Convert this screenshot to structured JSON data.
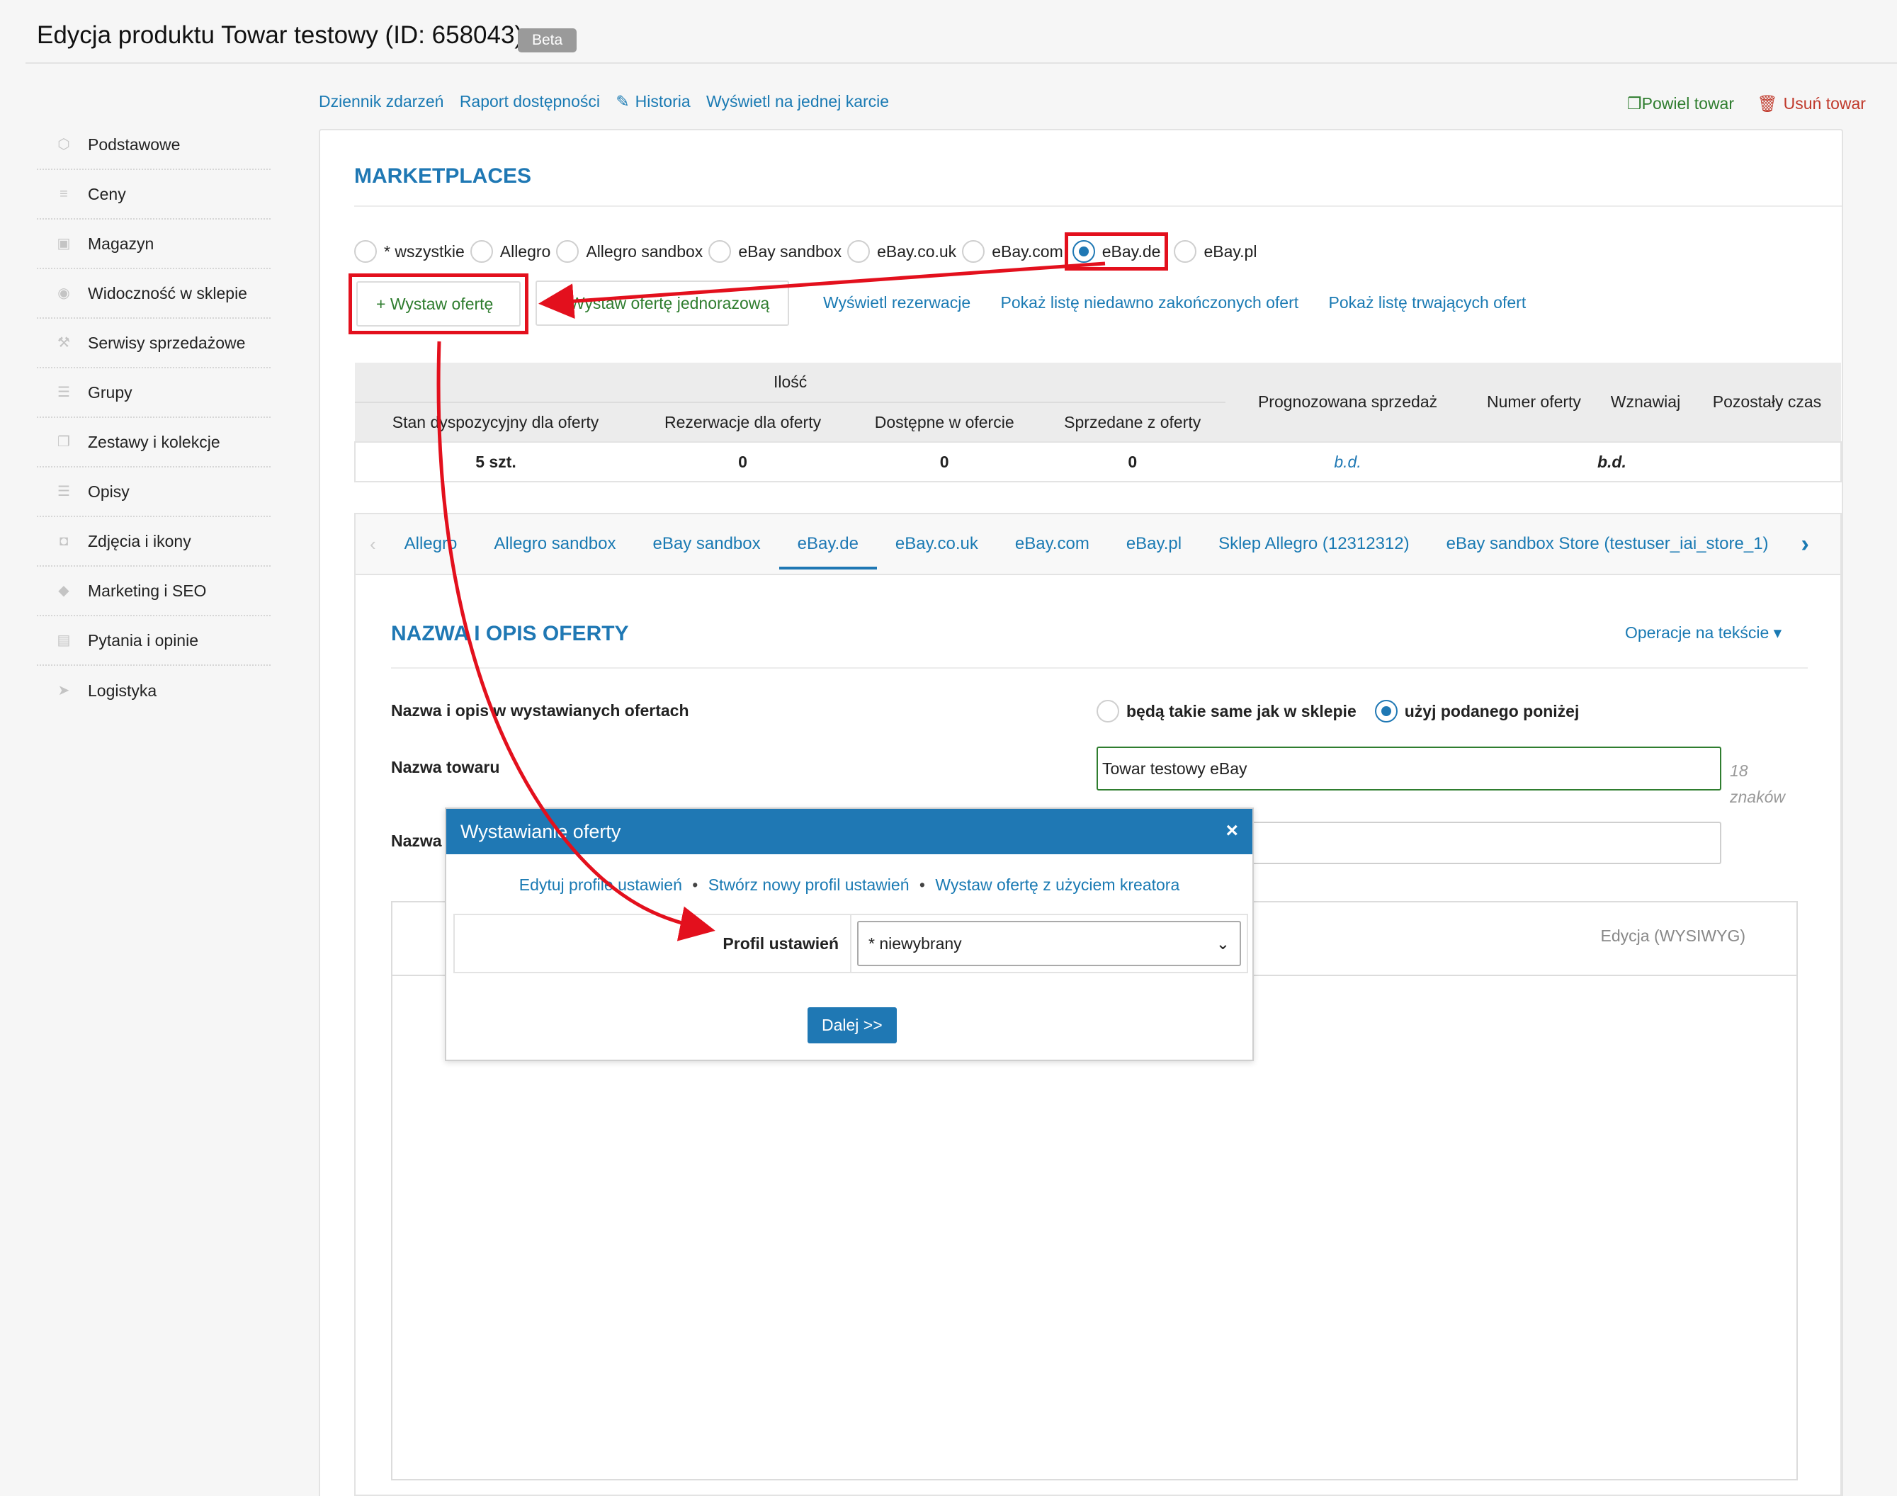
{
  "page": {
    "title": "Edycja produktu Towar testowy (ID: 658043)",
    "badge": "Beta"
  },
  "sidebar": {
    "items": [
      {
        "label": "Podstawowe",
        "icon": "cube-icon"
      },
      {
        "label": "Ceny",
        "icon": "coins-icon"
      },
      {
        "label": "Magazyn",
        "icon": "warehouse-icon"
      },
      {
        "label": "Widoczność w sklepie",
        "icon": "eye-icon"
      },
      {
        "label": "Serwisy sprzedażowe",
        "icon": "hammer-icon"
      },
      {
        "label": "Grupy",
        "icon": "layers-icon"
      },
      {
        "label": "Zestawy i kolekcje",
        "icon": "copy-icon"
      },
      {
        "label": "Opisy",
        "icon": "lines-icon"
      },
      {
        "label": "Zdjęcia i ikony",
        "icon": "camera-icon"
      },
      {
        "label": "Marketing i SEO",
        "icon": "tag-icon"
      },
      {
        "label": "Pytania i opinie",
        "icon": "chat-icon"
      },
      {
        "label": "Logistyka",
        "icon": "plane-icon"
      }
    ]
  },
  "toplinks": {
    "log": "Dziennik zdarzeń",
    "report": "Raport dostępności",
    "history": "Historia",
    "single_card": "Wyświetl na jednej karcie",
    "duplicate": "Powiel towar",
    "delete": "Usuń towar"
  },
  "marketplaces": {
    "title": "MARKETPLACES",
    "options": [
      "* wszystkie",
      "Allegro",
      "Allegro sandbox",
      "eBay sandbox",
      "eBay.co.uk",
      "eBay.com",
      "eBay.de",
      "eBay.pl"
    ],
    "selected": "eBay.de",
    "btn_offer": "+   Wystaw ofertę",
    "btn_single": "+   Wystaw ofertę jednorazową",
    "link_res": "Wyświetl rezerwacje",
    "link_ended": "Pokaż listę niedawno zakończonych ofert",
    "link_ongoing": "Pokaż listę trwających ofert"
  },
  "qty_table": {
    "group": "Ilość",
    "headers": [
      "Stan dyspozycyjny dla oferty",
      "Rezerwacje dla oferty",
      "Dostępne w ofercie",
      "Sprzedane z oferty",
      "Prognozowana sprzedaż",
      "Numer oferty",
      "Wznawiaj",
      "Pozostały czas"
    ],
    "row": {
      "stan": "5 szt.",
      "rez": "0",
      "dost": "0",
      "sprz": "0",
      "prog": "b.d.",
      "num": "b.d."
    }
  },
  "tabs": {
    "items": [
      "Allegro",
      "Allegro sandbox",
      "eBay sandbox",
      "eBay.de",
      "eBay.co.uk",
      "eBay.com",
      "eBay.pl",
      "Sklep Allegro (12312312)",
      "eBay sandbox Store (testuser_iai_store_1)"
    ],
    "active": "eBay.de"
  },
  "section": {
    "title": "NAZWA I OPIS OFERTY",
    "ops": "Operacje na tekście ▾",
    "row1_label": "Nazwa i opis w wystawianych ofertach",
    "opt_same": "będą takie same jak w sklepie",
    "opt_custom": "użyj podanego poniżej",
    "name_label": "Nazwa towaru",
    "name_value": "Towar testowy eBay",
    "char_count": "18",
    "char_unit": "znaków",
    "sub_label": "Nazwa",
    "editor_mode": "Edycja (WYSIWYG)"
  },
  "modal": {
    "title": "Wystawianie oferty",
    "close": "×",
    "link_edit": "Edytuj profile ustawień",
    "link_new": "Stwórz nowy profil ustawień",
    "link_wizard": "Wystaw ofertę z użyciem kreatora",
    "sep": "•",
    "profile_label": "Profil ustawień",
    "profile_value": "* niewybrany",
    "next": "Dalej >>"
  },
  "colors": {
    "accent": "#1f78b4",
    "annotation": "#e3101d",
    "green": "#2f7d2f",
    "red": "#c0392b"
  }
}
